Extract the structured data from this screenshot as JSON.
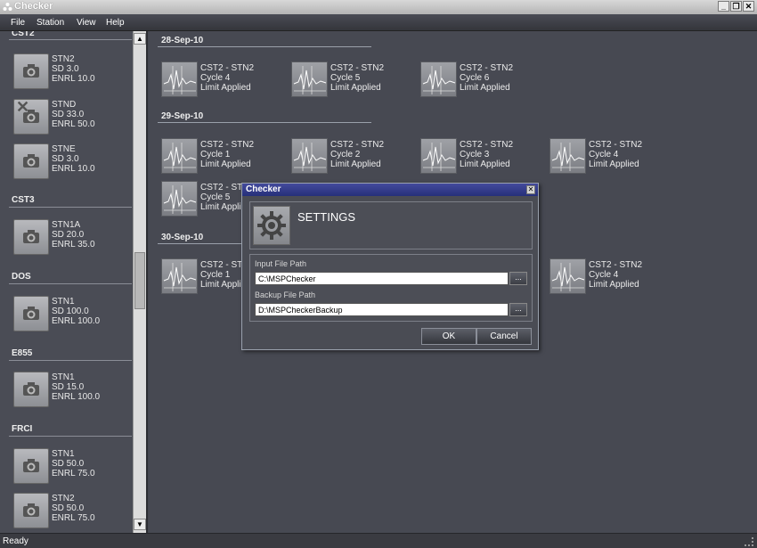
{
  "window": {
    "title": "Checker"
  },
  "menu": [
    "File",
    "Station",
    "View",
    "Help"
  ],
  "sidebar": {
    "groups": [
      {
        "name": "CST2",
        "stations": [
          {
            "name": "STN2",
            "sd": "SD 3.0",
            "enrl": "ENRL 10.0",
            "disabled": false
          },
          {
            "name": "STND",
            "sd": "SD 33.0",
            "enrl": "ENRL 50.0",
            "disabled": true
          },
          {
            "name": "STNE",
            "sd": "SD 3.0",
            "enrl": "ENRL 10.0",
            "disabled": false
          }
        ]
      },
      {
        "name": "CST3",
        "stations": [
          {
            "name": "STN1A",
            "sd": "SD 20.0",
            "enrl": "ENRL 35.0",
            "disabled": false
          }
        ]
      },
      {
        "name": "DOS",
        "stations": [
          {
            "name": "STN1",
            "sd": "SD 100.0",
            "enrl": "ENRL 100.0",
            "disabled": false
          }
        ]
      },
      {
        "name": "E855",
        "stations": [
          {
            "name": "STN1",
            "sd": "SD 15.0",
            "enrl": "ENRL 100.0",
            "disabled": false
          }
        ]
      },
      {
        "name": "FRCI",
        "stations": [
          {
            "name": "STN1",
            "sd": "SD 50.0",
            "enrl": "ENRL 75.0",
            "disabled": false
          },
          {
            "name": "STN2",
            "sd": "SD 50.0",
            "enrl": "ENRL 75.0",
            "disabled": false
          }
        ]
      }
    ]
  },
  "main": {
    "dates": [
      {
        "label": "28-Sep-10",
        "items": [
          {
            "title": "CST2 - STN2",
            "cycle": "Cycle 4",
            "status": "Limit Applied"
          },
          {
            "title": "CST2 - STN2",
            "cycle": "Cycle 5",
            "status": "Limit Applied"
          },
          {
            "title": "CST2 - STN2",
            "cycle": "Cycle 6",
            "status": "Limit Applied"
          }
        ]
      },
      {
        "label": "29-Sep-10",
        "items": [
          {
            "title": "CST2 - STN2",
            "cycle": "Cycle 1",
            "status": "Limit Applied"
          },
          {
            "title": "CST2 - STN2",
            "cycle": "Cycle 2",
            "status": "Limit Applied"
          },
          {
            "title": "CST2 - STN2",
            "cycle": "Cycle 3",
            "status": "Limit Applied"
          },
          {
            "title": "CST2 - STN2",
            "cycle": "Cycle 4",
            "status": "Limit Applied"
          },
          {
            "title": "CST2 - STN2",
            "cycle": "Cycle 5",
            "status": "Limit Applied"
          }
        ]
      },
      {
        "label": "30-Sep-10",
        "items": [
          {
            "title": "CST2 - STN2",
            "cycle": "Cycle 1",
            "status": "Limit Applied"
          },
          {
            "title": "CST2 - STN2",
            "cycle": "Cycle 4",
            "status": "Limit Applied"
          }
        ]
      }
    ]
  },
  "dialog": {
    "title": "Checker",
    "heading": "SETTINGS",
    "input_label": "Input File Path",
    "input_value": "C:\\MSPChecker",
    "backup_label": "Backup File Path",
    "backup_value": "D:\\MSPCheckerBackup",
    "browse_label": "...",
    "ok_label": "OK",
    "cancel_label": "Cancel"
  },
  "status": {
    "text": "Ready"
  }
}
